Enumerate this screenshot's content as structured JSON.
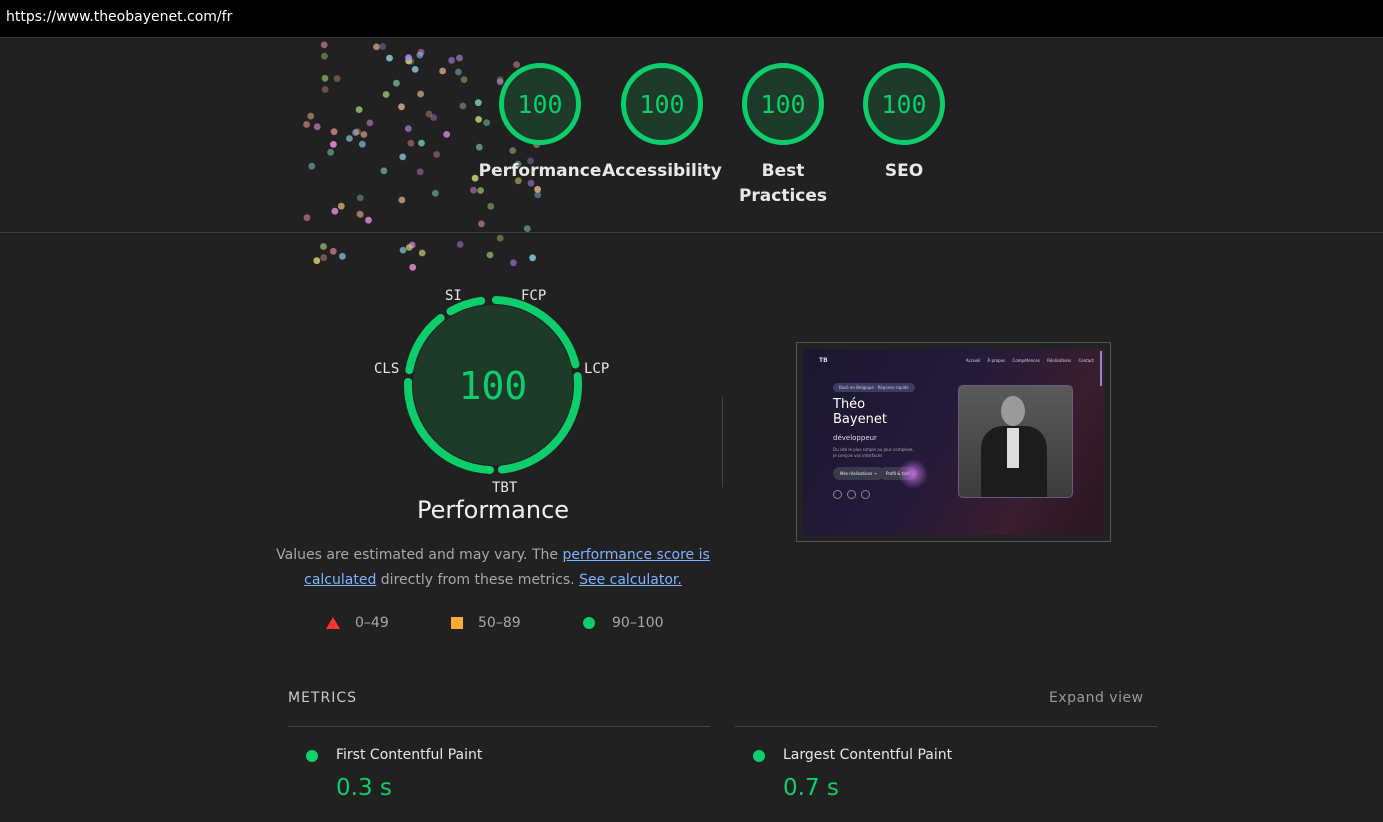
{
  "address_bar": {
    "url": "https://www.theobayenet.com/fr"
  },
  "colors": {
    "pass": "#0cce6b",
    "average": "#ffaa33",
    "fail": "#ff3333",
    "link": "#7fb2ff"
  },
  "categories": [
    {
      "score": "100",
      "label": "Performance"
    },
    {
      "score": "100",
      "label": "Accessibility"
    },
    {
      "score": "100",
      "label": "Best Practices"
    },
    {
      "score": "100",
      "label": "SEO"
    }
  ],
  "performance_gauge": {
    "score": "100",
    "title": "Performance",
    "metric_tags": {
      "si": "SI",
      "fcp": "FCP",
      "lcp": "LCP",
      "tbt": "TBT",
      "cls": "CLS"
    }
  },
  "note": {
    "prefix": "Values are estimated and may vary. The ",
    "link1": "performance score is calculated",
    "middle": " directly from these metrics.",
    "link2": "See calculator."
  },
  "legend": {
    "fail_range": "0–49",
    "average_range": "50–89",
    "pass_range": "90–100"
  },
  "final_screenshot": {
    "nav_links": [
      "Accueil",
      "À propos",
      "Compétences",
      "Réalisations",
      "Contact"
    ],
    "badge": "Basé en Belgique · Réponse rapide",
    "name_line1": "Théo",
    "name_line2": "Bayenet",
    "role": "développeur",
    "description": "Du site le plus simple au plus complexe, je conçois vos interfaces",
    "button1": "Mes réalisations →",
    "button2": "Profil & tarif"
  },
  "metrics": {
    "section_title": "METRICS",
    "expand_label": "Expand view",
    "items": [
      {
        "name": "First Contentful Paint",
        "value": "0.3 s"
      },
      {
        "name": "Largest Contentful Paint",
        "value": "0.7 s"
      }
    ]
  }
}
